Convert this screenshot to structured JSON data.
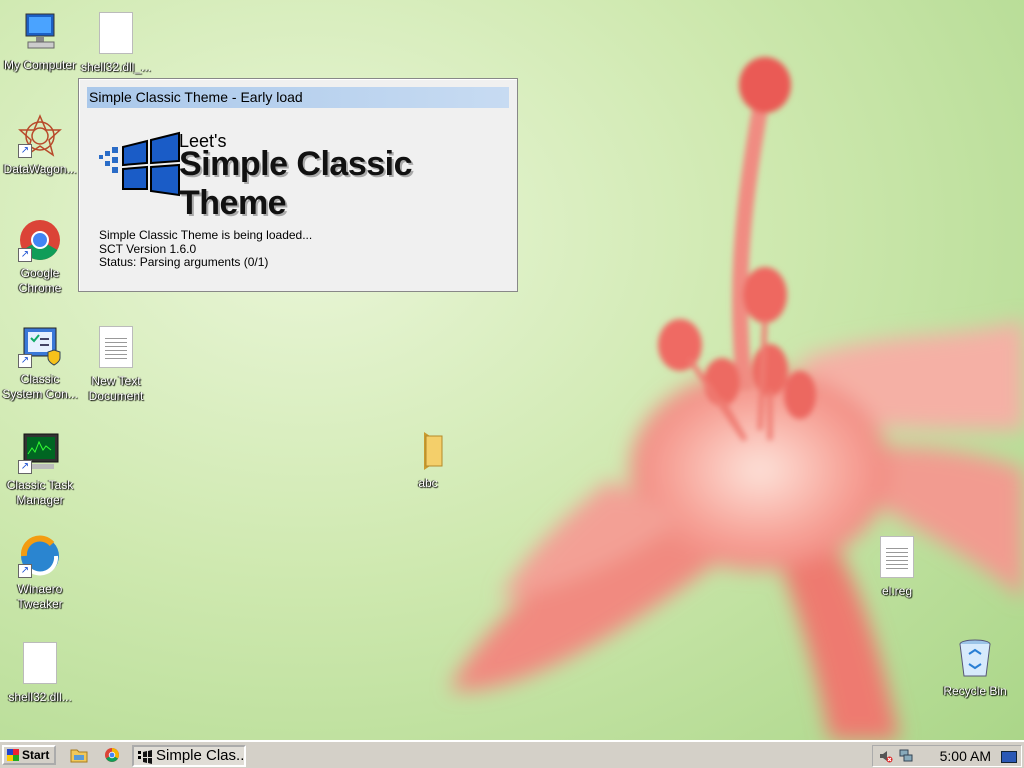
{
  "desktop": {
    "icons": [
      {
        "label": "My Computer",
        "icon": "computer-icon"
      },
      {
        "label": "shell32.dll_...",
        "icon": "file-icon"
      },
      {
        "label": "DataWagon...",
        "icon": "datawagon-icon"
      },
      {
        "label": "Google Chrome",
        "icon": "chrome-icon"
      },
      {
        "label": "Classic System Con...",
        "icon": "control-panel-icon"
      },
      {
        "label": "New Text Document",
        "icon": "text-document-icon"
      },
      {
        "label": "abc",
        "icon": "folder-icon"
      },
      {
        "label": "Classic Task Manager",
        "icon": "task-manager-icon"
      },
      {
        "label": "Winaero Tweaker",
        "icon": "winaero-icon"
      },
      {
        "label": "shell32.dll...",
        "icon": "file-icon"
      },
      {
        "label": "el.reg",
        "icon": "registry-file-icon"
      },
      {
        "label": "Recycle Bin",
        "icon": "recycle-bin-icon"
      }
    ]
  },
  "splash": {
    "title": "Simple Classic Theme - Early load",
    "brand_small": "Leet's",
    "brand_name": "Simple Classic Theme",
    "status_lines": [
      "Simple Classic Theme is being loaded...",
      "SCT Version 1.6.0",
      "Status: Parsing arguments (0/1)"
    ]
  },
  "taskbar": {
    "start_label": "Start",
    "quick_launch": [
      "explorer-icon",
      "chrome-icon"
    ],
    "task_label": "Simple Clas...",
    "clock": "5:00 AM",
    "tray_icons": [
      "volume-muted-icon",
      "network-icon"
    ]
  },
  "colors": {
    "titlebar_start": "#aac8ea",
    "taskbar": "#d4d0c8"
  }
}
